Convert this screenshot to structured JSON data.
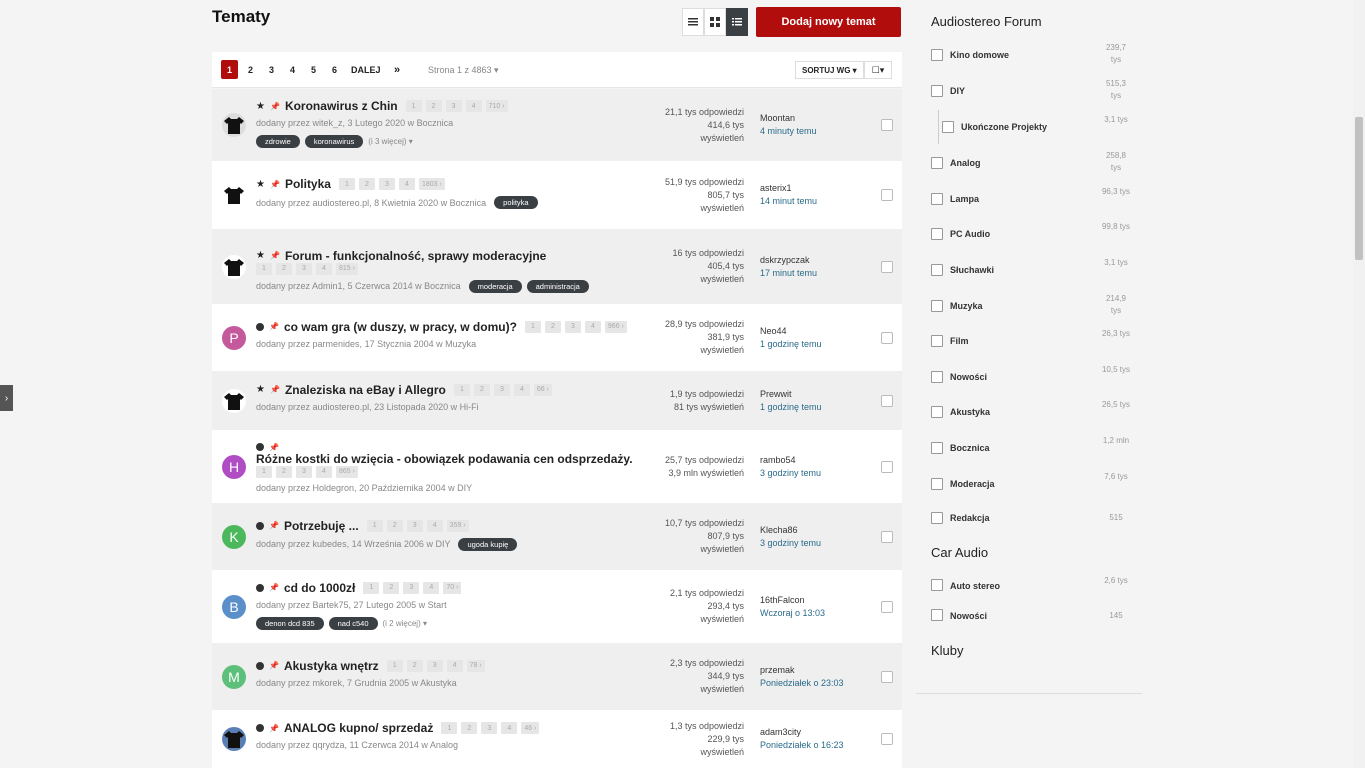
{
  "page_title": "Tematy",
  "add_button": "Dodaj nowy temat",
  "pagination": {
    "pages": [
      "1",
      "2",
      "3",
      "4",
      "5",
      "6"
    ],
    "next": "DALEJ",
    "last": "»",
    "page_of": "Strona 1 z 4863 ▾",
    "sort": "SORTUJ WG ▾",
    "select": "☐▾"
  },
  "topics": [
    {
      "icon": "★",
      "title": "Koronawirus z Chin",
      "pages": [
        "1",
        "2",
        "3",
        "4",
        "710 ›"
      ],
      "meta": "dodany przez witek_z, 3 Lutego 2020 w Bocznica",
      "tags": [
        "zdrowie",
        "koronawirus"
      ],
      "more": "(i 3 więcej) ▾",
      "tags_inline": false,
      "stats": [
        "21,1 tys odpowiedzi",
        "414,6 tys",
        "wyświetleń"
      ],
      "last_user": "Moontan",
      "last_time": "4 minuty temu",
      "avatar_letter": "",
      "avatar_color": "#ddd"
    },
    {
      "icon": "★",
      "title": "Polityka",
      "pages": [
        "1",
        "2",
        "3",
        "4",
        "1803 ›"
      ],
      "meta": "dodany przez audiostereo.pl, 8 Kwietnia 2020 w Bocznica",
      "tags": [
        "polityka"
      ],
      "more": "",
      "tags_inline": true,
      "stats": [
        "51,9 tys odpowiedzi",
        "805,7 tys",
        "wyświetleń"
      ],
      "last_user": "asterix1",
      "last_time": "14 minut temu",
      "avatar_letter": "",
      "avatar_color": "#fff"
    },
    {
      "icon": "★",
      "title": "Forum - funkcjonalność, sprawy moderacyjne",
      "pages": [
        "1",
        "2",
        "3",
        "4",
        "815 ›"
      ],
      "meta": "dodany przez Admin1, 5 Czerwca 2014 w Bocznica",
      "tags": [
        "moderacja",
        "administracja"
      ],
      "more": "",
      "tags_inline": true,
      "stats": [
        "16 tys odpowiedzi",
        "405,4 tys",
        "wyświetleń"
      ],
      "last_user": "dskrzypczak",
      "last_time": "17 minut temu",
      "avatar_letter": "",
      "avatar_color": "#fff"
    },
    {
      "icon": "●",
      "title": "co wam gra (w duszy, w pracy, w domu)?",
      "pages": [
        "1",
        "2",
        "3",
        "4",
        "966 ›"
      ],
      "meta": "dodany przez parmenides, 17 Stycznia 2004 w Muzyka",
      "tags": [],
      "more": "",
      "tags_inline": true,
      "stats": [
        "28,9 tys odpowiedzi",
        "381,9 tys",
        "wyświetleń"
      ],
      "last_user": "Neo44",
      "last_time": "1 godzinę temu",
      "avatar_letter": "P",
      "avatar_color": "#c45a9c"
    },
    {
      "icon": "★",
      "title": "Znaleziska na eBay i Allegro",
      "pages": [
        "1",
        "2",
        "3",
        "4",
        "66 ›"
      ],
      "meta": "dodany przez audiostereo.pl, 23 Listopada 2020 w Hi-Fi",
      "tags": [],
      "more": "",
      "tags_inline": true,
      "stats": [
        "1,9 tys odpowiedzi",
        "81 tys wyświetleń"
      ],
      "last_user": "Prewwit",
      "last_time": "1 godzinę temu",
      "avatar_letter": "",
      "avatar_color": "#fff"
    },
    {
      "icon": "●",
      "title": "Różne kostki do wzięcia - obowiązek podawania cen odsprzedaży.",
      "pages": [
        "1",
        "2",
        "3",
        "4",
        "865 ›"
      ],
      "meta": "dodany przez Holdegron, 20 Października 2004 w DIY",
      "tags": [],
      "more": "",
      "tags_inline": true,
      "stats": [
        "25,7 tys odpowiedzi",
        "3,9 mln wyświetleń"
      ],
      "last_user": "rambo54",
      "last_time": "3 godziny temu",
      "avatar_letter": "H",
      "avatar_color": "#b04cc4"
    },
    {
      "icon": "●",
      "title": "Potrzebuję ...",
      "pages": [
        "1",
        "2",
        "3",
        "4",
        "359 ›"
      ],
      "meta": "dodany przez kubedes, 14 Września 2006 w DIY",
      "tags": [
        "ugoda kupię"
      ],
      "more": "",
      "tags_inline": true,
      "stats": [
        "10,7 tys odpowiedzi",
        "807,9 tys",
        "wyświetleń"
      ],
      "last_user": "Klecha86",
      "last_time": "3 godziny temu",
      "avatar_letter": "K",
      "avatar_color": "#4cb85c"
    },
    {
      "icon": "●",
      "title": "cd do 1000zł",
      "pages": [
        "1",
        "2",
        "3",
        "4",
        "70 ›"
      ],
      "meta": "dodany przez Bartek75, 27 Lutego 2005 w Start",
      "tags": [
        "denon dcd 835",
        "nad c540"
      ],
      "more": "(i 2 więcej) ▾",
      "tags_inline": false,
      "stats": [
        "2,1 tys odpowiedzi",
        "293,4 tys",
        "wyświetleń"
      ],
      "last_user": "16thFalcon",
      "last_time": "Wczoraj o 13:03",
      "avatar_letter": "B",
      "avatar_color": "#5a8fc9"
    },
    {
      "icon": "●",
      "title": "Akustyka wnętrz",
      "pages": [
        "1",
        "2",
        "3",
        "4",
        "78 ›"
      ],
      "meta": "dodany przez mkorek, 7 Grudnia 2005 w Akustyka",
      "tags": [],
      "more": "",
      "tags_inline": true,
      "stats": [
        "2,3 tys odpowiedzi",
        "344,9 tys",
        "wyświetleń"
      ],
      "last_user": "przemak",
      "last_time": "Poniedziałek o 23:03",
      "avatar_letter": "M",
      "avatar_color": "#5cbf7a"
    },
    {
      "icon": "●",
      "title": "ANALOG kupno/ sprzedaż",
      "pages": [
        "1",
        "2",
        "3",
        "4",
        "46 ›"
      ],
      "meta": "dodany przez qqrydza, 11 Czerwca 2014 w Analog",
      "tags": [],
      "more": "",
      "tags_inline": true,
      "stats": [
        "1,3 tys odpowiedzi",
        "229,9 tys",
        "wyświetleń"
      ],
      "last_user": "adam3city",
      "last_time": "Poniedziałek o 16:23",
      "avatar_letter": "",
      "avatar_color": "#5a7fb5"
    }
  ],
  "sidebar": {
    "audiostereo_title": "Audiostereo Forum",
    "audiostereo_items": [
      {
        "label": "Kino domowe",
        "count": "239,7 tys"
      },
      {
        "label": "DIY",
        "count": "515,3 tys"
      },
      {
        "label": "Ukończone Projekty",
        "count": "3,1 tys"
      },
      {
        "label": "Analog",
        "count": "258,8 tys"
      },
      {
        "label": "Lampa",
        "count": "96,3 tys"
      },
      {
        "label": "PC Audio",
        "count": "99,8 tys"
      },
      {
        "label": "Słuchawki",
        "count": "3,1 tys"
      },
      {
        "label": "Muzyka",
        "count": "214,9 tys"
      },
      {
        "label": "Film",
        "count": "26,3 tys"
      },
      {
        "label": "Nowości",
        "count": "10,5 tys"
      },
      {
        "label": "Akustyka",
        "count": "26,5 tys"
      },
      {
        "label": "Bocznica",
        "count": "1,2 mln"
      },
      {
        "label": "Moderacja",
        "count": "7,6 tys"
      },
      {
        "label": "Redakcja",
        "count": "515"
      }
    ],
    "car_title": "Car Audio",
    "car_items": [
      {
        "label": "Auto stereo",
        "count": "2,6 tys"
      },
      {
        "label": "Nowości",
        "count": "145"
      }
    ],
    "clubs_title": "Kluby"
  }
}
